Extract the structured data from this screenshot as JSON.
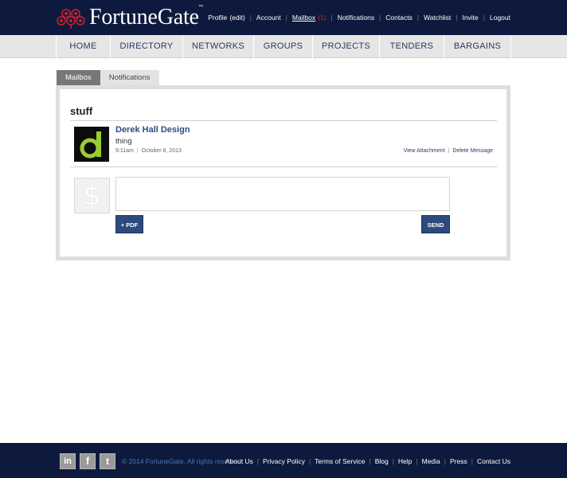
{
  "header": {
    "brand": "FortuneGate",
    "trademark": "™",
    "nav": {
      "profile": "Profile",
      "profile_edit": "(edit)",
      "account": "Account",
      "mailbox": "Mailbox",
      "mailbox_count": "(1)",
      "notifications": "Notifications",
      "contacts": "Contacts",
      "watchlist": "Watchlist",
      "invite": "Invite",
      "logout": "Logout"
    }
  },
  "main_nav": [
    {
      "label": "HOME"
    },
    {
      "label": "DIRECTORY"
    },
    {
      "label": "NETWORKS"
    },
    {
      "label": "GROUPS"
    },
    {
      "label": "PROJECTS"
    },
    {
      "label": "TENDERS"
    },
    {
      "label": "BARGAINS"
    }
  ],
  "tabs": {
    "mailbox": "Mailbox",
    "notifications": "Notifications"
  },
  "thread": {
    "subject": "stuff",
    "message": {
      "sender": "Derek Hall Design",
      "body": "thing",
      "time": "9:11am",
      "date": "October 8, 2013",
      "view_attachment": "View Attachment",
      "delete_message": "Delete Message"
    },
    "reply": {
      "placeholder": "",
      "pdf_button": "+ PDF",
      "send_button": "SEND"
    }
  },
  "footer": {
    "social": {
      "linkedin": "in",
      "facebook": "f",
      "twitter": "t"
    },
    "copyright": "© 2014 FortuneGate. All rights reserved.",
    "links": [
      "About Us",
      "Privacy Policy",
      "Terms of Service",
      "Blog",
      "Help",
      "Media",
      "Press",
      "Contact Us"
    ]
  },
  "colors": {
    "header_bg": "#0e1a3d",
    "accent_red": "#d9222a",
    "button_blue": "#2e4a7d",
    "avatar_green": "#9acd32"
  }
}
